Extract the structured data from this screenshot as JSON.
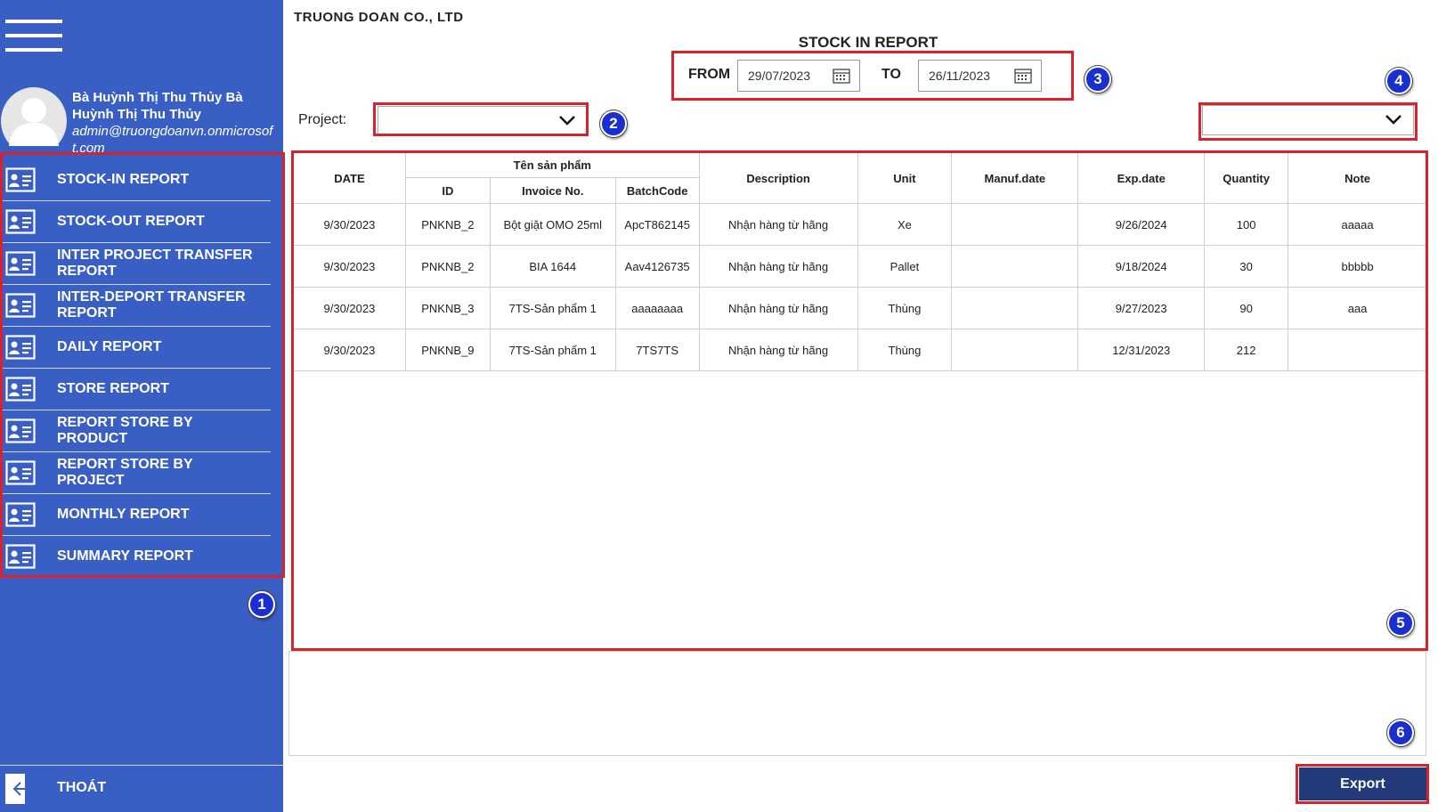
{
  "company": "TRUONG DOAN CO., LTD",
  "title": "STOCK IN REPORT",
  "user": {
    "name": "Bà Huỳnh Thị Thu Thủy Bà Huỳnh Thị Thu Thủy",
    "email": "admin@truongdoanvn.onmicrosoft.com"
  },
  "menu": [
    {
      "label": "STOCK-IN REPORT",
      "icon": "id-card-icon"
    },
    {
      "label": "STOCK-OUT REPORT",
      "icon": "id-card-icon"
    },
    {
      "label": "INTER PROJECT TRANSFER REPORT",
      "icon": "id-card-icon"
    },
    {
      "label": "INTER-DEPORT TRANSFER REPORT",
      "icon": "id-card-icon"
    },
    {
      "label": "DAILY REPORT",
      "icon": "id-card-icon"
    },
    {
      "label": "STORE REPORT",
      "icon": "id-card-icon"
    },
    {
      "label": "REPORT STORE BY PRODUCT",
      "icon": "id-card-icon"
    },
    {
      "label": "REPORT STORE BY PROJECT",
      "icon": "id-card-icon"
    },
    {
      "label": "MONTHLY REPORT",
      "icon": "id-card-icon"
    },
    {
      "label": "SUMMARY REPORT",
      "icon": "id-card-icon"
    }
  ],
  "exit_label": "THOÁT",
  "filters": {
    "from_label": "FROM",
    "from_value": "29/07/2023",
    "to_label": "TO",
    "to_value": "26/11/2023",
    "project_label": "Project:",
    "project_value": "",
    "right_dropdown_value": ""
  },
  "badges": [
    "1",
    "2",
    "3",
    "4",
    "5",
    "6"
  ],
  "table": {
    "group_header": "Tên sản phẩm",
    "headers": {
      "date": "DATE",
      "id": "ID",
      "invoice": "Invoice No.",
      "batch": "BatchCode",
      "description": "Description",
      "unit": "Unit",
      "manuf": "Manuf.date",
      "exp": "Exp.date",
      "quantity": "Quantity",
      "note": "Note"
    },
    "rows": [
      {
        "date": "9/30/2023",
        "id": "PNKNB_2",
        "invoice": "Bột giặt OMO 25ml",
        "batch": "ApcT862145",
        "description": "Nhận hàng từ hãng",
        "unit": "Xe",
        "manuf": "",
        "exp": "9/26/2024",
        "quantity": "100",
        "note": "aaaaa"
      },
      {
        "date": "9/30/2023",
        "id": "PNKNB_2",
        "invoice": "BIA 1644",
        "batch": "Aav4126735",
        "description": "Nhận hàng từ hãng",
        "unit": "Pallet",
        "manuf": "",
        "exp": "9/18/2024",
        "quantity": "30",
        "note": "bbbbb"
      },
      {
        "date": "9/30/2023",
        "id": "PNKNB_3",
        "invoice": "7TS-Sản phẩm 1",
        "batch": "aaaaaaaa",
        "description": "Nhận hàng từ hãng",
        "unit": "Thùng",
        "manuf": "",
        "exp": "9/27/2023",
        "quantity": "90",
        "note": "aaa"
      },
      {
        "date": "9/30/2023",
        "id": "PNKNB_9",
        "invoice": "7TS-Sản phẩm 1",
        "batch": "7TS7TS",
        "description": "Nhận hàng từ hãng",
        "unit": "Thùng",
        "manuf": "",
        "exp": "12/31/2023",
        "quantity": "212",
        "note": ""
      }
    ]
  },
  "export_label": "Export",
  "colors": {
    "sidebar": "#3a5fc4",
    "annotation": "#d8232a",
    "badge": "#1a2fd0",
    "export": "#223a7a"
  }
}
